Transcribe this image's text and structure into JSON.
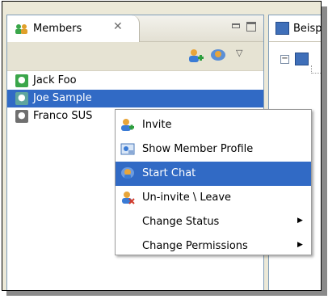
{
  "members_view": {
    "tab_title": "Members",
    "tab_close_glyph": "✕",
    "toolbar": {
      "invite_icon": "add-user-icon",
      "chat_icon": "chat-icon",
      "menu_glyph": "▽"
    },
    "members": [
      {
        "name": "Jack Foo",
        "icon": "user-online-icon",
        "selected": false
      },
      {
        "name": "Joe Sample",
        "icon": "user-online-icon",
        "selected": true
      },
      {
        "name": "Franco SUS",
        "icon": "user-offline-icon",
        "selected": false
      }
    ]
  },
  "side_view": {
    "tab_title": "Beisp",
    "tree_expander": "−"
  },
  "context_menu": {
    "items": [
      {
        "label": "Invite",
        "icon": "invite-icon",
        "active": false,
        "submenu": false
      },
      {
        "label": "Show Member Profile",
        "icon": "profile-icon",
        "active": false,
        "submenu": false
      },
      {
        "label": "Start Chat",
        "icon": "chat-icon",
        "active": true,
        "submenu": false
      },
      {
        "label": "Un-invite \\ Leave",
        "icon": "uninvite-icon",
        "active": false,
        "submenu": false
      },
      {
        "label": "Change Status",
        "icon": "",
        "active": false,
        "submenu": true
      },
      {
        "label": "Change Permissions",
        "icon": "",
        "active": false,
        "submenu": true
      }
    ],
    "submenu_arrow": "▶"
  },
  "colors": {
    "selection": "#316ac5",
    "online": "#3aa64a",
    "offline": "#6f6f6f"
  }
}
